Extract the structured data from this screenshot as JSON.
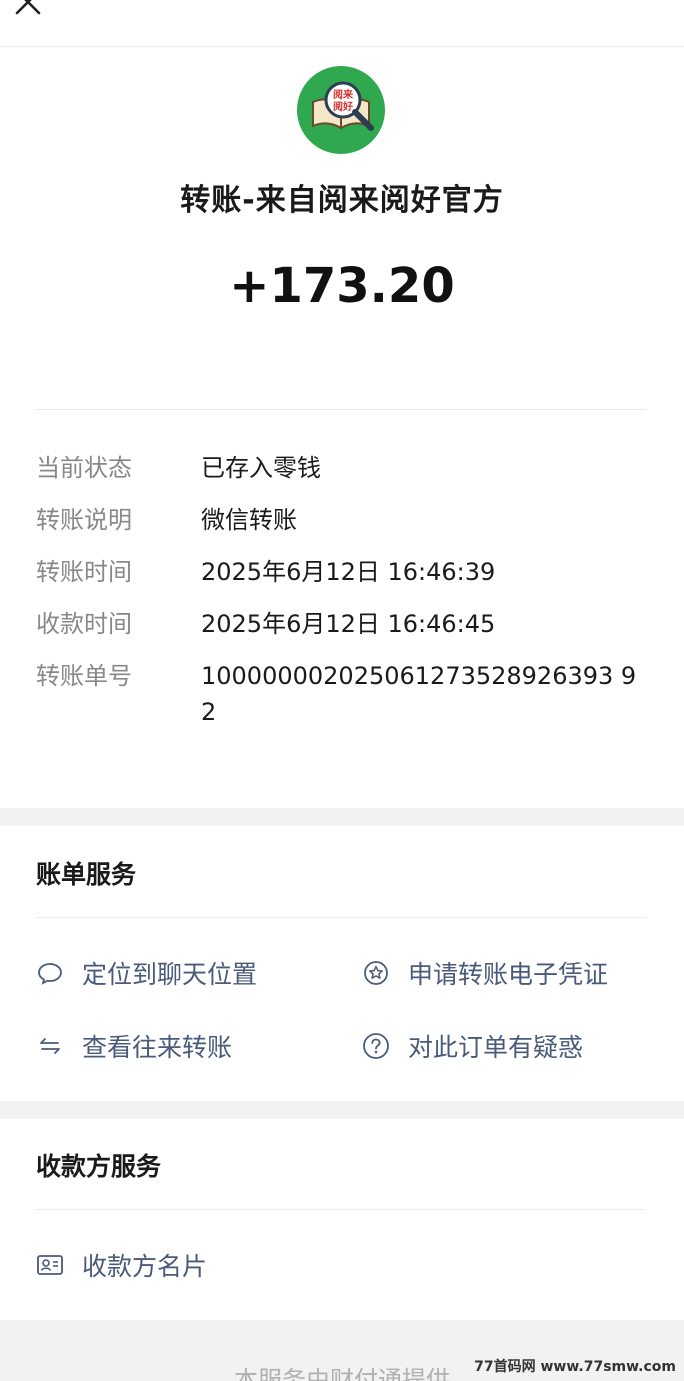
{
  "header": {
    "title": "转账-来自阅来阅好官方",
    "amount": "+173.20",
    "logo_text": "阅来阅好"
  },
  "details": [
    {
      "label": "当前状态",
      "value": "已存入零钱"
    },
    {
      "label": "转账说明",
      "value": "微信转账"
    },
    {
      "label": "转账时间",
      "value": "2025年6月12日 16:46:39"
    },
    {
      "label": "收款时间",
      "value": "2025年6月12日 16:46:45"
    },
    {
      "label": "转账单号",
      "value": "100000002025061273528926393 92"
    }
  ],
  "bill_services": {
    "title": "账单服务",
    "items": [
      {
        "label": "定位到聊天位置",
        "icon": "chat-bubble-icon"
      },
      {
        "label": "申请转账电子凭证",
        "icon": "star-badge-icon"
      },
      {
        "label": "查看往来转账",
        "icon": "swap-arrows-icon"
      },
      {
        "label": "对此订单有疑惑",
        "icon": "question-icon"
      }
    ]
  },
  "payee_services": {
    "title": "收款方服务",
    "items": [
      {
        "label": "收款方名片",
        "icon": "contact-card-icon"
      }
    ]
  },
  "footer": {
    "text": "本服务由财付通提供"
  },
  "watermark": "77首码网 www.77smw.com",
  "colors": {
    "logo_bg": "#2fa84f",
    "link_text": "#4a5a7a",
    "label_gray": "#888888",
    "section_gap": "#f2f2f2"
  }
}
